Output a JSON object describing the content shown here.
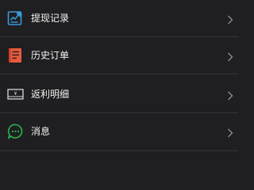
{
  "menu": {
    "items": [
      {
        "label": "提现记录",
        "icon": "withdrawal-record-icon",
        "icon_color": "#3a9ad9"
      },
      {
        "label": "历史订单",
        "icon": "order-history-icon",
        "icon_color": "#e85a3c"
      },
      {
        "label": "返利明细",
        "icon": "rebate-detail-icon",
        "icon_color": "#d7d7d7"
      },
      {
        "label": "消息",
        "icon": "message-icon",
        "icon_color": "#2bb24c"
      }
    ]
  },
  "colors": {
    "background": "#1f1f21",
    "divider": "#343436",
    "text": "#f2f2f2",
    "chevron": "#8a8a8a"
  }
}
